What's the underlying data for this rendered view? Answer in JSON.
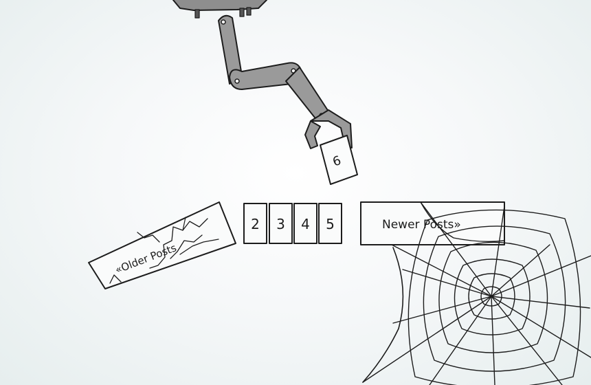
{
  "pagination": {
    "older_label": "«Older Posts",
    "pages": [
      "2",
      "3",
      "4",
      "5"
    ],
    "newer_label": "Newer Posts»",
    "incoming_page": "6"
  }
}
